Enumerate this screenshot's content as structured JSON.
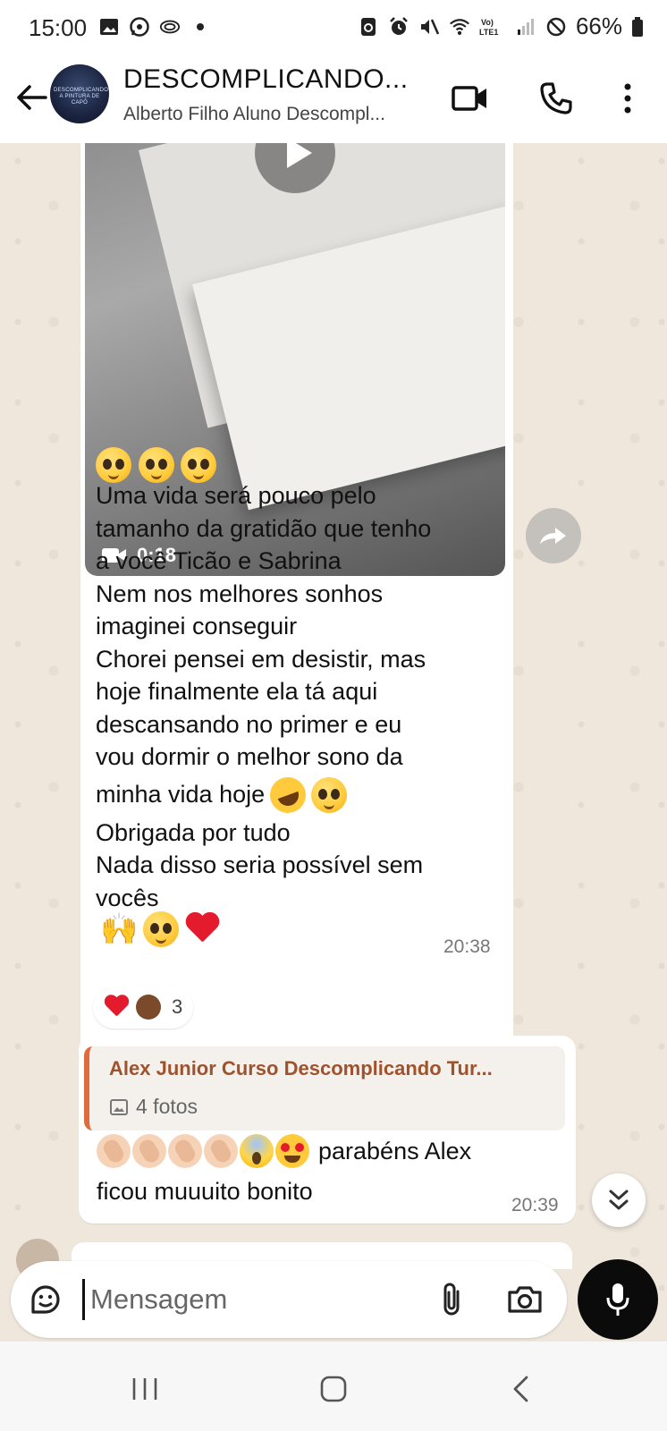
{
  "status_bar": {
    "time": "15:00",
    "battery": "66%",
    "left_icons": [
      "gallery-icon",
      "whatsapp-icon",
      "cast-icon",
      "dot-icon"
    ],
    "right_icons": [
      "sync-icon",
      "alarm-icon",
      "mute-icon",
      "wifi-icon",
      "volte-icon",
      "signal-icon",
      "no-sim-icon",
      "battery-icon"
    ]
  },
  "header": {
    "title": "DESCOMPLICANDO...",
    "subtitle": "Alberto Filho Aluno Descompl...",
    "avatar_text": "DESCOMPLICANDO A PINTURA DE CAPÔ",
    "icons": [
      "back-arrow-icon",
      "video-call-icon",
      "phone-icon",
      "more-vertical-icon"
    ]
  },
  "messages": [
    {
      "type": "video",
      "duration": "0:18",
      "emoji_top": [
        "pleading-face",
        "pleading-face",
        "pleading-face"
      ],
      "lines": [
        "Uma vida será pouco pelo",
        "tamanho da gratidão que tenho",
        "a você Ticão e Sabrina",
        "Nem nos melhores sonhos",
        "imaginei conseguir",
        "Chorei pensei em desistir, mas",
        "hoje finalmente ela tá aqui",
        "descansando no primer e eu",
        "vou dormir o melhor sono da",
        "minha vida hoje",
        "Obrigada por tudo",
        "Nada disso seria possível sem",
        "vocês"
      ],
      "time": "20:38",
      "reactions": {
        "emojis": [
          "red-heart",
          "clapping-hands"
        ],
        "count": "3"
      }
    },
    {
      "type": "reply",
      "quoted_author": "Alex Junior Curso Descomplicando Tur...",
      "quoted_meta": "4 fotos",
      "text_line1": "parabéns Alex",
      "text_line2": "ficou muuuito bonito",
      "time": "20:39"
    }
  ],
  "input": {
    "placeholder": "Mensagem"
  },
  "colors": {
    "chat_bg": "#efe7dc",
    "bubble": "#ffffff",
    "quote_accent": "#e06a3b",
    "quote_author": "#a0522d"
  }
}
